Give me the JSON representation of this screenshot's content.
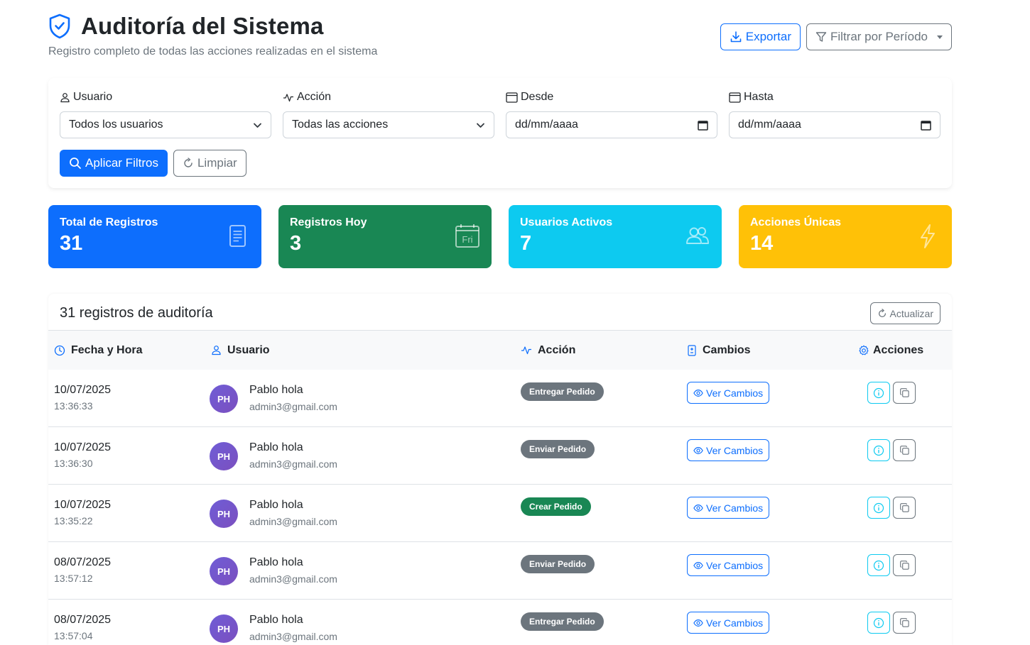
{
  "header": {
    "title": "Auditoría del Sistema",
    "subtitle": "Registro completo de todas las acciones realizadas en el sistema",
    "export_label": "Exportar",
    "period_label": "Filtrar por Período"
  },
  "filters": {
    "user_label": "Usuario",
    "user_value": "Todos los usuarios",
    "action_label": "Acción",
    "action_value": "Todas las acciones",
    "from_label": "Desde",
    "from_value": "dd/mm/aaaa",
    "to_label": "Hasta",
    "to_value": "dd/mm/aaaa",
    "apply_label": "Aplicar Filtros",
    "clear_label": "Limpiar"
  },
  "stats": [
    {
      "label": "Total de Registros",
      "value": "31",
      "color": "#0d6efd",
      "icon": "document-icon"
    },
    {
      "label": "Registros Hoy",
      "value": "3",
      "color": "#198754",
      "icon": "calendar-icon"
    },
    {
      "label": "Usuarios Activos",
      "value": "7",
      "color": "#0dcaf0",
      "icon": "users-icon"
    },
    {
      "label": "Acciones Únicas",
      "value": "14",
      "color": "#ffc107",
      "icon": "lightning-icon"
    }
  ],
  "calendar_day": "Fri",
  "table": {
    "title": "31 registros de auditoría",
    "refresh_label": "Actualizar",
    "headers": {
      "date": "Fecha y Hora",
      "user": "Usuario",
      "action": "Acción",
      "changes": "Cambios",
      "actions": "Acciones"
    },
    "view_changes_label": "Ver Cambios",
    "rows": [
      {
        "date": "10/07/2025",
        "time": "13:36:33",
        "initials": "PH",
        "name": "Pablo hola",
        "email": "admin3@gmail.com",
        "action": "Entregar Pedido",
        "action_color": "#6c757d"
      },
      {
        "date": "10/07/2025",
        "time": "13:36:30",
        "initials": "PH",
        "name": "Pablo hola",
        "email": "admin3@gmail.com",
        "action": "Enviar Pedido",
        "action_color": "#6c757d"
      },
      {
        "date": "10/07/2025",
        "time": "13:35:22",
        "initials": "PH",
        "name": "Pablo hola",
        "email": "admin3@gmail.com",
        "action": "Crear Pedido",
        "action_color": "#198754"
      },
      {
        "date": "08/07/2025",
        "time": "13:57:12",
        "initials": "PH",
        "name": "Pablo hola",
        "email": "admin3@gmail.com",
        "action": "Enviar Pedido",
        "action_color": "#6c757d"
      },
      {
        "date": "08/07/2025",
        "time": "13:57:04",
        "initials": "PH",
        "name": "Pablo hola",
        "email": "admin3@gmail.com",
        "action": "Entregar Pedido",
        "action_color": "#6c757d"
      }
    ]
  }
}
